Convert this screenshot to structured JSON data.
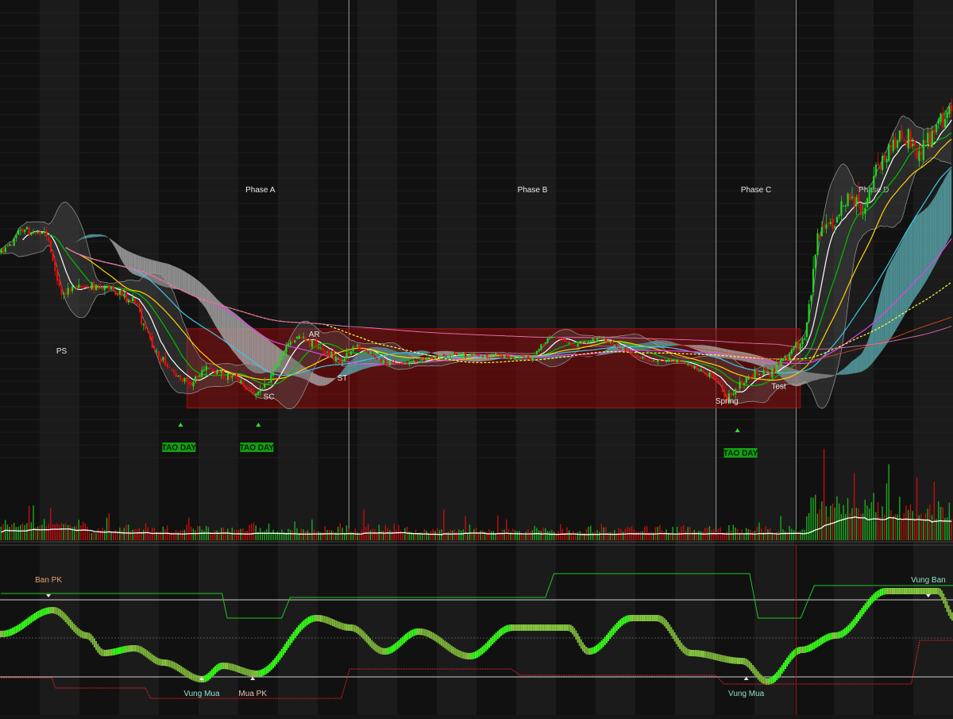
{
  "chart_data": {
    "type": "candlestick",
    "phases": [
      {
        "label": "Phase A",
        "start_bar": 79,
        "end_bar": 161
      },
      {
        "label": "Phase B",
        "start_bar": 161,
        "end_bar": 331
      },
      {
        "label": "Phase C",
        "start_bar": 331,
        "end_bar": 368
      },
      {
        "label": "Phase D",
        "start_bar": 368,
        "end_bar": 440
      }
    ],
    "annotations": [
      {
        "label": "PS",
        "bar": 28,
        "price": 40.2
      },
      {
        "label": "AR",
        "bar": 145,
        "price": 42.8
      },
      {
        "label": "SC",
        "bar": 124,
        "price": 33.0
      },
      {
        "label": "ST",
        "bar": 158,
        "price": 35.9
      },
      {
        "label": "Spring",
        "bar": 336,
        "price": 32.3
      },
      {
        "label": "Test",
        "bar": 360,
        "price": 34.6
      }
    ],
    "signal_badges": [
      {
        "label": "TAO DAY",
        "bar": 82
      },
      {
        "label": "TAO DAY",
        "bar": 118
      },
      {
        "label": "TAO DAY",
        "bar": 342
      }
    ],
    "trading_range": {
      "start_bar": 86,
      "end_bar": 370,
      "high": 44.1,
      "low": 31.6
    },
    "price_anchors": [
      [
        0,
        56.0
      ],
      [
        10,
        60.0
      ],
      [
        22,
        58.5
      ],
      [
        24,
        54.0
      ],
      [
        28,
        50.0
      ],
      [
        38,
        51.0
      ],
      [
        55,
        49.6
      ],
      [
        62,
        48.5
      ],
      [
        72,
        40.0
      ],
      [
        80,
        37.0
      ],
      [
        87,
        35.2
      ],
      [
        95,
        38.0
      ],
      [
        110,
        36.0
      ],
      [
        118,
        33.5
      ],
      [
        124,
        36.0
      ],
      [
        130,
        40.0
      ],
      [
        137,
        43.0
      ],
      [
        143,
        42.0
      ],
      [
        150,
        40.5
      ],
      [
        158,
        39.0
      ],
      [
        165,
        41.5
      ],
      [
        175,
        39.0
      ],
      [
        185,
        38.5
      ],
      [
        195,
        39.2
      ],
      [
        210,
        40.0
      ],
      [
        230,
        39.8
      ],
      [
        245,
        39.5
      ],
      [
        255,
        43.0
      ],
      [
        265,
        41.5
      ],
      [
        278,
        42.5
      ],
      [
        288,
        40.8
      ],
      [
        300,
        38.8
      ],
      [
        312,
        39.2
      ],
      [
        322,
        37.8
      ],
      [
        330,
        36.5
      ],
      [
        336,
        33.0
      ],
      [
        345,
        36.5
      ],
      [
        356,
        37.2
      ],
      [
        365,
        40.5
      ],
      [
        372,
        42.5
      ],
      [
        378,
        58.0
      ],
      [
        385,
        61.0
      ],
      [
        392,
        64.0
      ],
      [
        400,
        63.5
      ],
      [
        405,
        69.0
      ],
      [
        410,
        72.0
      ],
      [
        418,
        74.5
      ],
      [
        426,
        71.5
      ],
      [
        432,
        76.0
      ],
      [
        440,
        78.0
      ]
    ],
    "series": [
      {
        "name": "",
        "kind": "sma",
        "period": 10,
        "color": "#ffffff"
      },
      {
        "name": "",
        "kind": "sma",
        "period": 20,
        "color": "#00c000"
      },
      {
        "name": "",
        "kind": "sma",
        "period": 35,
        "color": "#ffd200"
      },
      {
        "name": "",
        "kind": "sma",
        "period": 60,
        "color": "#3fc7e6"
      },
      {
        "name": "",
        "kind": "sma",
        "period": 100,
        "color": "#e640e6"
      },
      {
        "name": "",
        "kind": "sma",
        "period": 150,
        "color": "#ffff40"
      },
      {
        "name": "",
        "kind": "sma",
        "period": 300,
        "color": "#d04a20"
      },
      {
        "name": "",
        "kind": "sma",
        "period": 360,
        "color": "#e26bb3"
      }
    ],
    "bollinger": {
      "period": 20,
      "stdev": 2
    },
    "volume_panel": {
      "ma_period": 20
    },
    "oscillator_panel": {
      "labels": [
        {
          "label": "Ban PK",
          "bar": 28,
          "pos": "upper",
          "color": "#e8a070"
        },
        {
          "label": "Vung Mua",
          "bar": 118,
          "pos": "lower",
          "color": "#8fe0c8"
        },
        {
          "label": "Mua PK",
          "bar": 148,
          "pos": "lower",
          "color": "#f0c0b0"
        },
        {
          "label": "Vung Mua",
          "bar": 438,
          "pos": "lower",
          "color": "#8fe0c8"
        },
        {
          "label": "Vung Ban",
          "bar": 545,
          "pos": "upper",
          "color": "#8fe0c8"
        }
      ]
    },
    "colors": {
      "up": "#1ed81e",
      "down": "#e80c0c",
      "range_fill": "#8a0a0a",
      "cloud": "#aaaaaa",
      "cloud_teal": "#5aa9ae",
      "osc_up": "#37ff1a",
      "osc_mid": "#8acf42",
      "osc_down": "#7eb63a"
    }
  }
}
